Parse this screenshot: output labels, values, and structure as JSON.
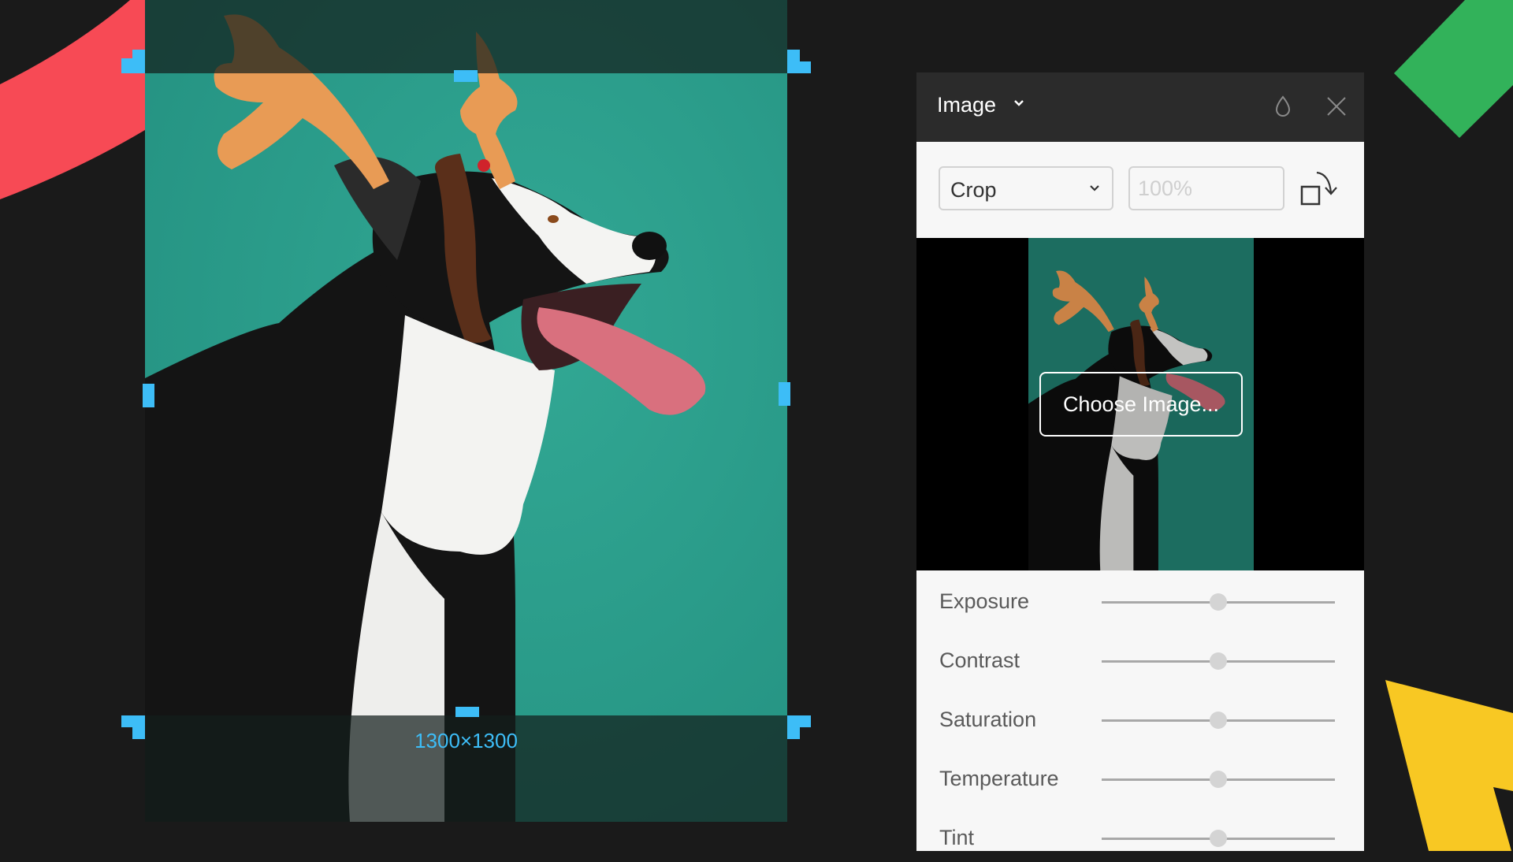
{
  "canvas": {
    "size_label": "1300×1300",
    "accent_color": "#3dbdf7"
  },
  "panel": {
    "title": "Image",
    "header_icons": [
      "chevron-down-icon",
      "drop-icon",
      "close-icon"
    ],
    "toolbar": {
      "mode_select": {
        "value": "Crop",
        "options_visible": [
          "Crop"
        ]
      },
      "zoom_input": {
        "value": "",
        "placeholder": "100%"
      },
      "rotate_icon": "rotate-icon"
    },
    "preview": {
      "choose_button_label": "Choose Image..."
    },
    "adjustments": [
      {
        "label": "Exposure",
        "value": 0.5
      },
      {
        "label": "Contrast",
        "value": 0.5
      },
      {
        "label": "Saturation",
        "value": 0.5
      },
      {
        "label": "Temperature",
        "value": 0.5
      },
      {
        "label": "Tint",
        "value": 0.5
      }
    ]
  },
  "decorations": {
    "red": "#f74a55",
    "green": "#32b25a",
    "yellow": "#f8c823",
    "background": "#1a1a1a"
  }
}
